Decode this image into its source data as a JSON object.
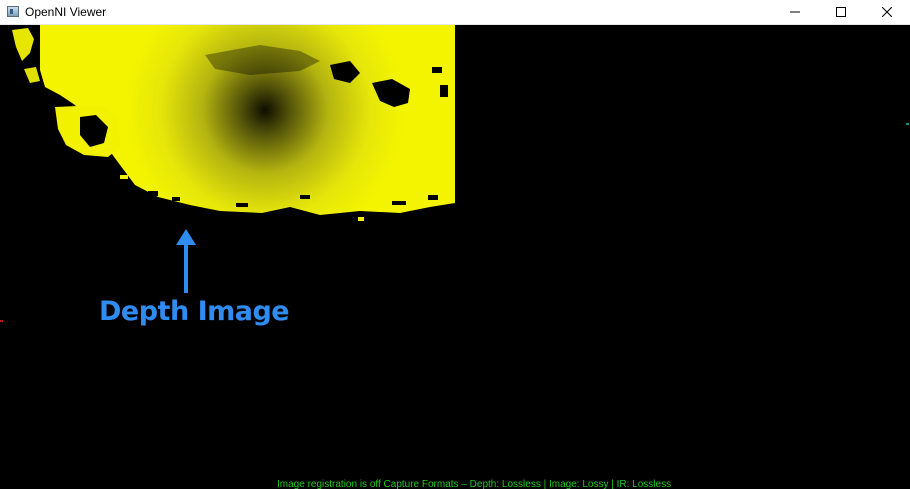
{
  "window": {
    "title": "OpenNI Viewer",
    "icon": "app-window-icon",
    "controls": [
      "minimize-icon",
      "maximize-icon",
      "close-icon"
    ]
  },
  "viewer": {
    "annotation_label": "Depth Image",
    "annotation_color": "#2f8cf0",
    "depth_color": "#f0f000",
    "status_text": "Image registration is off   Capture Formats – Depth: Lossless | Image: Lossy | IR: Lossless",
    "status_color": "#22c81e"
  }
}
